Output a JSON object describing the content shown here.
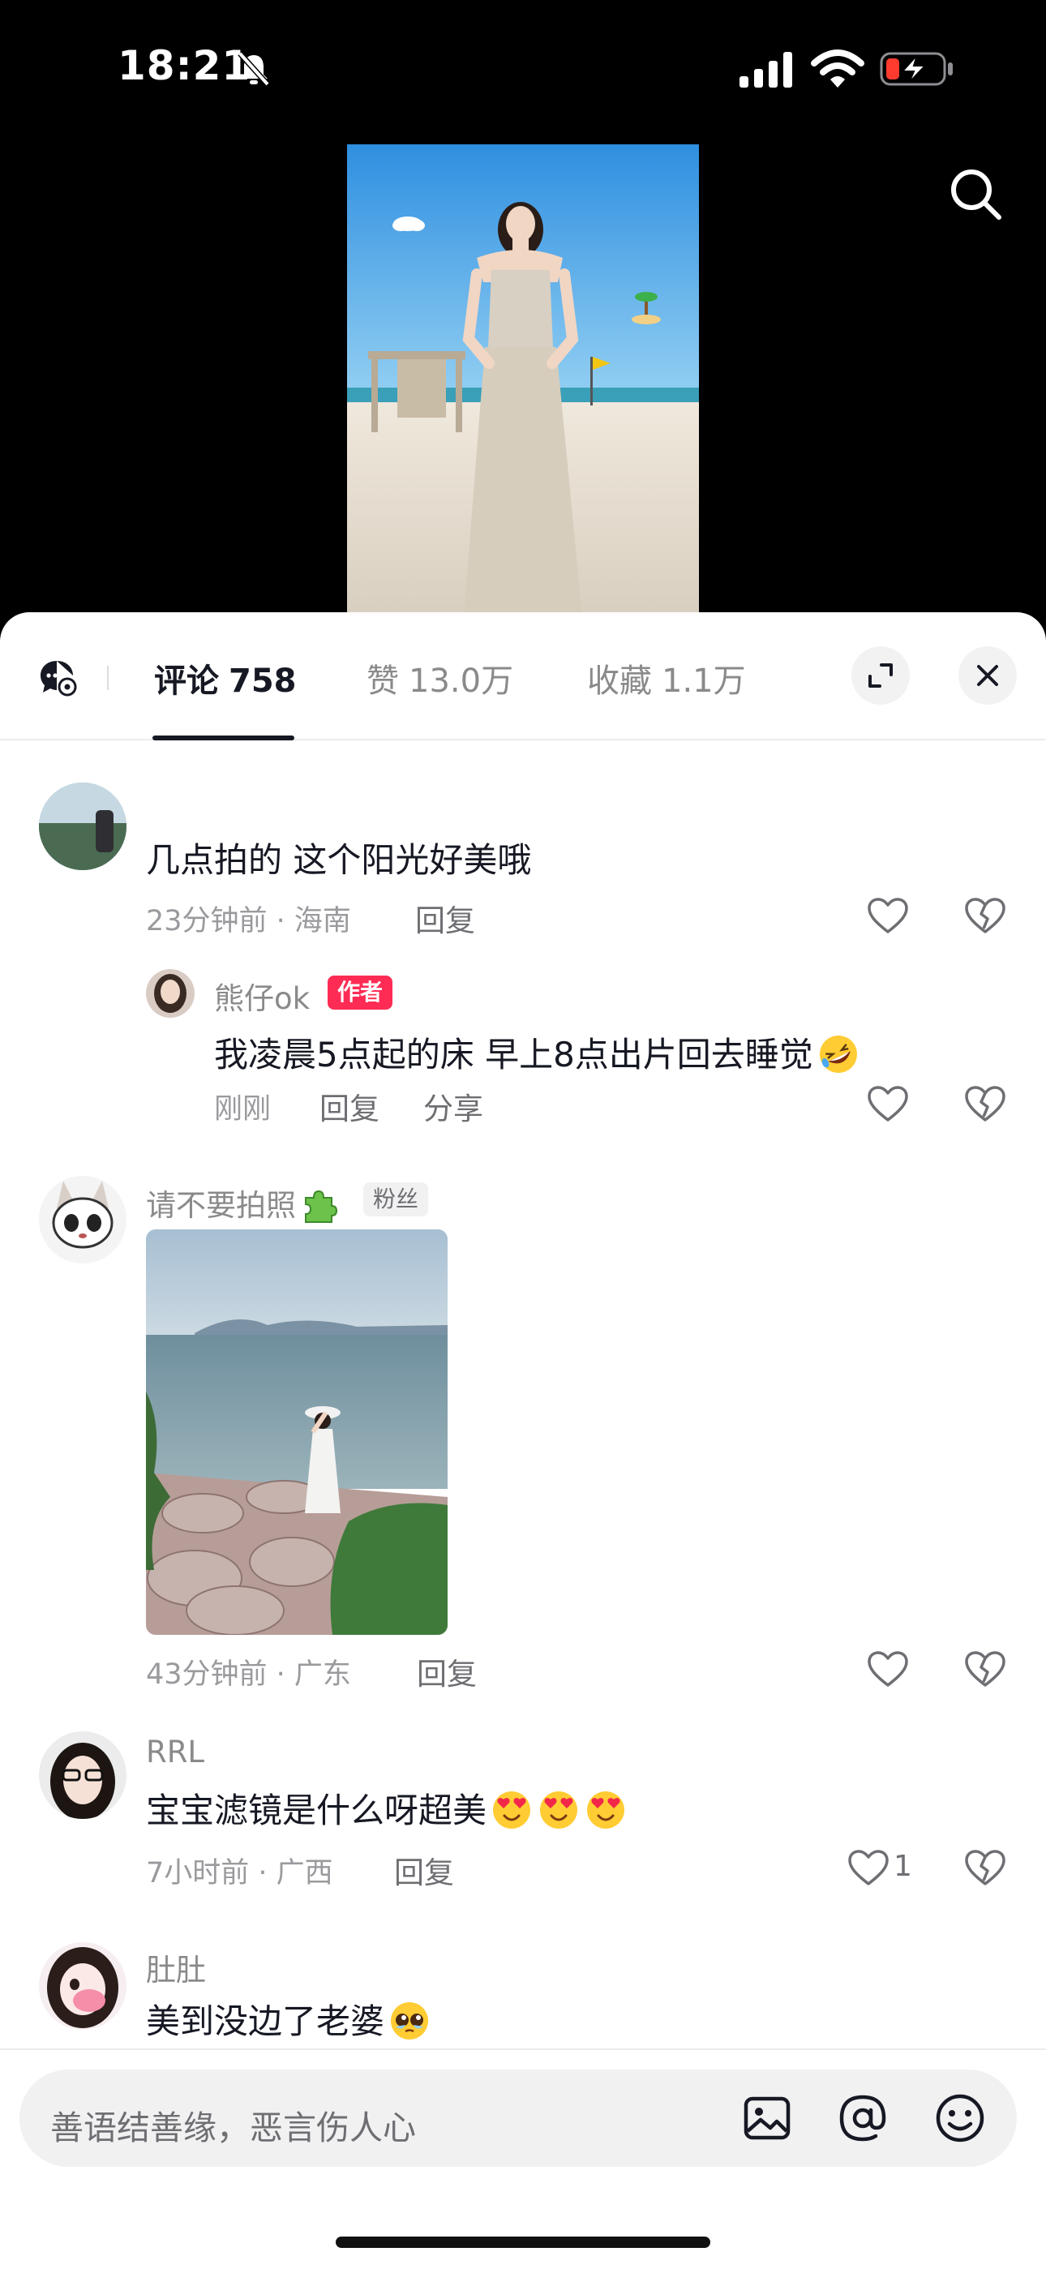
{
  "status_bar": {
    "time": "18:21"
  },
  "tabs": [
    {
      "label": "评论",
      "count": "758",
      "active": true
    },
    {
      "label": "赞",
      "count": "13.0万",
      "active": false
    },
    {
      "label": "收藏",
      "count": "1.1万",
      "active": false
    }
  ],
  "comments": [
    {
      "username": "",
      "text": "几点拍的 这个阳光好美哦",
      "meta": "23分钟前 · 海南",
      "reply_label": "回复",
      "replies": [
        {
          "username": "熊仔ok",
          "badge": "作者",
          "text": "我凌晨5点起的床 早上8点出片回去睡觉",
          "emoji": "rofl-emoji",
          "meta": "刚刚",
          "reply_label": "回复",
          "share_label": "分享"
        }
      ]
    },
    {
      "username": "请不要拍照",
      "username_emoji": "puzzle-emoji",
      "badge": "粉丝",
      "text": "",
      "image": "beach-photo-image",
      "meta": "43分钟前 · 广东",
      "reply_label": "回复"
    },
    {
      "username": "RRL",
      "text": "宝宝滤镜是什么呀超美",
      "emojis": [
        "heart-eyes-emoji",
        "heart-eyes-emoji",
        "heart-eyes-emoji"
      ],
      "meta": "7小时前 · 广西",
      "reply_label": "回复",
      "likes": "1"
    },
    {
      "username": "肚肚",
      "text": "美到没边了老婆",
      "emoji": "pleading-emoji"
    }
  ],
  "input": {
    "placeholder": "善语结善缘，恶言伤人心"
  },
  "icons": {
    "search": "search-icon",
    "danmaku": "danmaku-icon",
    "expand": "expand-icon",
    "close": "close-icon",
    "like": "heart-icon",
    "dislike": "broken-heart-icon",
    "image": "image-icon",
    "mention": "at-icon",
    "emoji": "emoji-icon"
  },
  "colors": {
    "accent": "#fe2c55",
    "text": "#161823",
    "secondary": "#9a9a9e"
  }
}
